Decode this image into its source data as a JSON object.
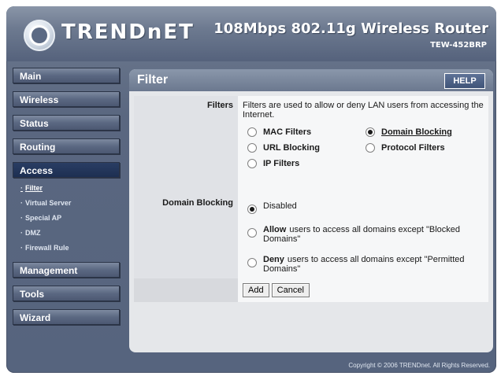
{
  "brand": {
    "name": "TRENDnET"
  },
  "header": {
    "product": "108Mbps 802.11g Wireless Router",
    "model": "TEW-452BRP"
  },
  "nav": {
    "main": "Main",
    "wireless": "Wireless",
    "status": "Status",
    "routing": "Routing",
    "access": "Access",
    "sub": [
      "Filter",
      "Virtual Server",
      "Special AP",
      "DMZ",
      "Firewall Rule"
    ],
    "management": "Management",
    "tools": "Tools",
    "wizard": "Wizard"
  },
  "panel": {
    "title": "Filter",
    "help": "HELP",
    "filters_label": "Filters",
    "filters_desc": "Filters are used to allow or deny LAN users from accessing the Internet.",
    "options": {
      "mac": "MAC Filters",
      "domain": "Domain Blocking",
      "url": "URL Blocking",
      "protocol": "Protocol Filters",
      "ip": "IP Filters"
    },
    "selected_filter": "Domain Blocking",
    "domain_label": "Domain Blocking",
    "domain_disabled": "Disabled",
    "allow_bold": "Allow",
    "allow_rest": "users to access all domains except \"Blocked Domains\"",
    "deny_bold": "Deny",
    "deny_rest": "users to access all domains except \"Permitted Domains\"",
    "selected_domain_mode": "Disabled",
    "add": "Add",
    "cancel": "Cancel"
  },
  "footer": {
    "copyright": "Copyright © 2006 TRENDnet. All Rights Reserved."
  },
  "colors": {
    "frame": "#5a6780",
    "active_nav": "#1d2f52",
    "panel_bg": "#e5e7ea"
  }
}
